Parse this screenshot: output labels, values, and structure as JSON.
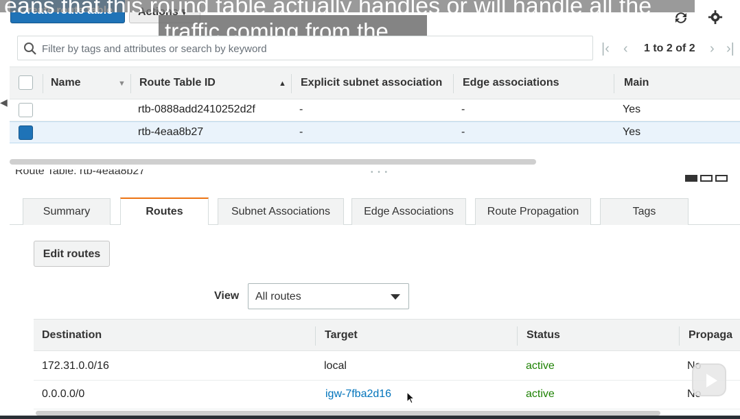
{
  "toolbar": {
    "create_label": "Create route table",
    "actions_label": "Actions ▾"
  },
  "captions": {
    "line1": "eans that this round table actually handles or will handle all the",
    "line2": "traffic coming from the"
  },
  "filter": {
    "placeholder": "Filter by tags and attributes or search by keyword"
  },
  "pager": {
    "text": "1 to 2 of 2"
  },
  "route_tables": {
    "columns": [
      "Name",
      "Route Table ID",
      "Explicit subnet association",
      "Edge associations",
      "Main"
    ],
    "rows": [
      {
        "name": "",
        "id": "rtb-0888add2410252d2f",
        "subnet": "-",
        "edge": "-",
        "main": "Yes",
        "selected": false
      },
      {
        "name": "",
        "id": "rtb-4eaa8b27",
        "subnet": "-",
        "edge": "-",
        "main": "Yes",
        "selected": true
      }
    ]
  },
  "detail": {
    "title": "Route Table: rtb-4eaa8b27",
    "tabs": [
      "Summary",
      "Routes",
      "Subnet Associations",
      "Edge Associations",
      "Route Propagation",
      "Tags"
    ],
    "active_tab": "Routes",
    "edit_label": "Edit routes",
    "view_label": "View",
    "view_value": "All routes"
  },
  "routes": {
    "columns": [
      "Destination",
      "Target",
      "Status",
      "Propaga"
    ],
    "rows": [
      {
        "destination": "172.31.0.0/16",
        "target": "local",
        "status": "active",
        "propagated": "No"
      },
      {
        "destination": "0.0.0.0/0",
        "target": "igw-7fba2d16",
        "status": "active",
        "propagated": "No"
      }
    ]
  },
  "colors": {
    "primary": "#1f73b7",
    "active_tab_accent": "#ec7211",
    "status_active": "#1d8102",
    "link": "#0073bb"
  }
}
